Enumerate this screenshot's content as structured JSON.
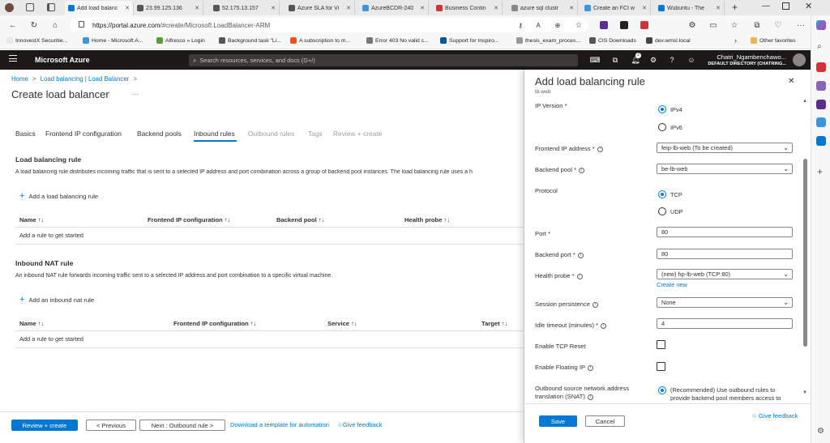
{
  "browser": {
    "tabs": [
      {
        "label": "Add load balanc",
        "active": true,
        "color": "#0078d4"
      },
      {
        "label": "23.99.125.136",
        "color": "#555555"
      },
      {
        "label": "52.175.13.157",
        "color": "#555555"
      },
      {
        "label": "Azure SLA for Vi",
        "color": "#555555"
      },
      {
        "label": "AzureBCDR-240",
        "color": "#3a96dd"
      },
      {
        "label": "Business Contin",
        "color": "#d13438"
      },
      {
        "label": "azure sql clustr",
        "color": "#888888"
      },
      {
        "label": "Create an FCI w",
        "color": "#3a96dd"
      },
      {
        "label": "Wubuntu - The",
        "color": "#0078d4"
      }
    ],
    "new_tab": "+",
    "url_host": "https://portal.azure.com",
    "url_path": "/#create/Microsoft.LoadBalancer-ARM",
    "favorites": [
      {
        "label": "InnovestX Securitie...",
        "color": "#e8e8e8"
      },
      {
        "label": "Home - Microsoft A...",
        "color": "#3a96dd"
      },
      {
        "label": "Alfresco » Login",
        "color": "#5c9e31"
      },
      {
        "label": "Background task \"Li...",
        "color": "#555555"
      },
      {
        "label": "A subscription to m...",
        "color": "#f25022"
      },
      {
        "label": "Error 403 No valid c...",
        "color": "#777777"
      },
      {
        "label": "Support for Inspiro...",
        "color": "#0058a3"
      },
      {
        "label": "thesis_exam_proces...",
        "color": "#999999"
      },
      {
        "label": "CIS Downloads",
        "color": "#555555"
      },
      {
        "label": "dev.wmsl.local",
        "color": "#444444"
      }
    ],
    "other_favorites": "Other favorites"
  },
  "azure": {
    "brand": "Microsoft Azure",
    "search_placeholder": "Search resources, services, and docs (G+/)",
    "notif_count": "2",
    "user_name": "Chatri_Ngambenchawo...",
    "directory": "DEFAULT DIRECTORY (CHATRING..."
  },
  "page": {
    "breadcrumb_home": "Home",
    "breadcrumb_sep": ">",
    "breadcrumb_lb": "Load balancing | Load Balancer",
    "title": "Create load balancer",
    "ellipsis": "···",
    "tabs": [
      "Basics",
      "Frontend IP configuration",
      "Backend pools",
      "Inbound rules",
      "Outbound rules",
      "Tags",
      "Review + create"
    ],
    "lb_rule_heading": "Load balancing rule",
    "lb_rule_desc": "A load balancing rule distributes incoming traffic that is sent to a selected IP address and port combination across a group of backend pool instances. The load balancing rule uses a h",
    "add_lb_rule": "Add a load balancing rule",
    "lb_columns": [
      "Name ↑↓",
      "Frontend IP configuration ↑↓",
      "Backend pool ↑↓",
      "Health probe ↑↓"
    ],
    "lb_empty": "Add a rule to get started",
    "nat_heading": "Inbound NAT rule",
    "nat_desc": "An inbound NAT rule forwards incoming traffic sent to a selected IP address and port combination to a specific virtual machine.",
    "add_nat_rule": "Add an inbound nat rule",
    "nat_columns": [
      "Name ↑↓",
      "Frontend IP configuration ↑↓",
      "Service ↑↓",
      "Target ↑↓"
    ],
    "nat_empty": "Add a rule to get started",
    "review_create": "Review + create",
    "previous": "< Previous",
    "next": "Next : Outbound rule >",
    "download_template": "Download a template for automation",
    "give_feedback": "Give feedback"
  },
  "panel": {
    "title": "Add load balancing rule",
    "subtitle": "lb-web",
    "ip_version_label": "IP Version *",
    "ipv4": "IPv4",
    "ipv6": "IPv6",
    "frontend_label": "Frontend IP address *",
    "frontend_value": "feip-lb-web (To be created)",
    "backend_pool_label": "Backend pool *",
    "backend_pool_value": "be-lb-web",
    "protocol_label": "Protocol",
    "tcp": "TCP",
    "udp": "UDP",
    "port_label": "Port *",
    "port_value": "80",
    "backend_port_label": "Backend port *",
    "backend_port_value": "80",
    "health_probe_label": "Health probe *",
    "health_probe_value": "(new) hp-lb-web (TCP:80)",
    "create_new": "Create new",
    "session_label": "Session persistence",
    "session_value": "None",
    "idle_label": "Idle timeout (minutes) *",
    "idle_value": "4",
    "tcp_reset_label": "Enable TCP Reset",
    "floating_label": "Enable Floating IP",
    "snat_label_1": "Outbound source network address",
    "snat_label_2": "translation (SNAT)",
    "snat_option_1": "(Recommended) Use outbound rules to",
    "snat_option_2": "provide backend pool members access to",
    "save": "Save",
    "cancel": "Cancel",
    "give_feedback": "Give feedback"
  },
  "colors": {
    "azure_blue": "#0078d4",
    "header_bg": "#1b1a19"
  }
}
